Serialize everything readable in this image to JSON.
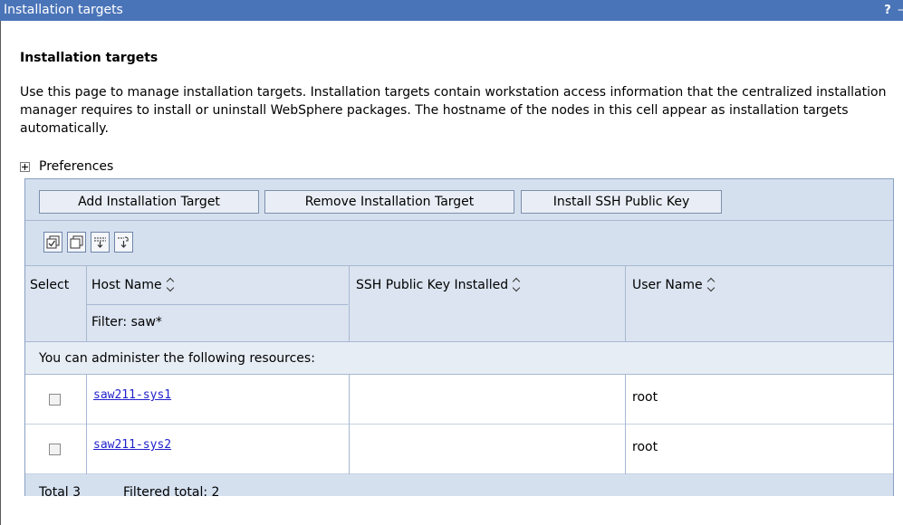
{
  "window": {
    "title": "Installation targets",
    "help_label": "?",
    "minimize_label": "–"
  },
  "page": {
    "heading": "Installation targets",
    "description": "Use this page to manage installation targets. Installation targets contain workstation access information that the centralized installation manager requires to install or uninstall WebSphere packages. The hostname of the nodes in this cell appear as installation targets automatically.",
    "preferences_label": "Preferences"
  },
  "toolbar": {
    "buttons": [
      "Add Installation Target",
      "Remove Installation Target",
      "Install SSH Public Key"
    ],
    "icons": [
      "select-all-icon",
      "deselect-all-icon",
      "show-filter-icon",
      "clear-filter-icon"
    ]
  },
  "table": {
    "columns": [
      "Select",
      "Host Name",
      "SSH Public Key Installed",
      "User Name"
    ],
    "filter_text": "Filter: saw*",
    "resources_note": "You can administer the following resources:",
    "rows": [
      {
        "host": "saw211-sys1",
        "ssh_installed": "",
        "user": "root",
        "selected": false
      },
      {
        "host": "saw211-sys2",
        "ssh_installed": "",
        "user": "root",
        "selected": false
      }
    ],
    "total_label": "Total 3",
    "filtered_label": "Filtered total: 2"
  }
}
